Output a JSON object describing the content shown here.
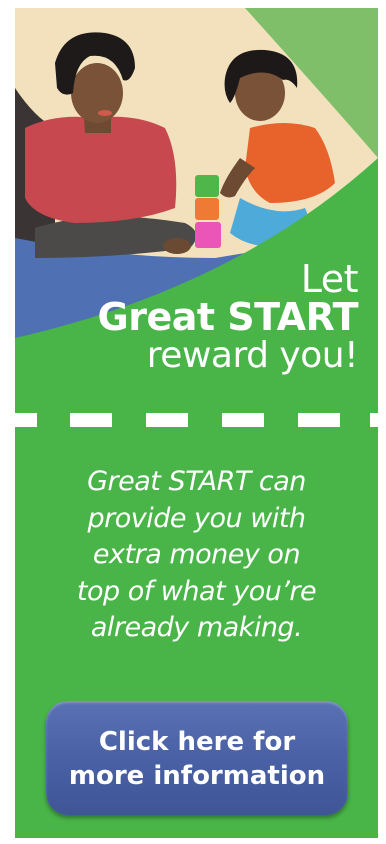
{
  "banner": {
    "headline_line1": "Let",
    "headline_brand": "Great START",
    "headline_line3": "reward you!",
    "body_text": "Great START can\nprovide you with\nextra money on\ntop of what you’re\nalready making.",
    "cta_label": "Click here for\nmore information",
    "colors": {
      "background_green": "#49b548",
      "button_blue": "#4b62a6",
      "text_white": "#ffffff",
      "scene_cream": "#f3e2bf"
    },
    "illustration": "mother-and-child-stacking-blocks-illustration"
  }
}
